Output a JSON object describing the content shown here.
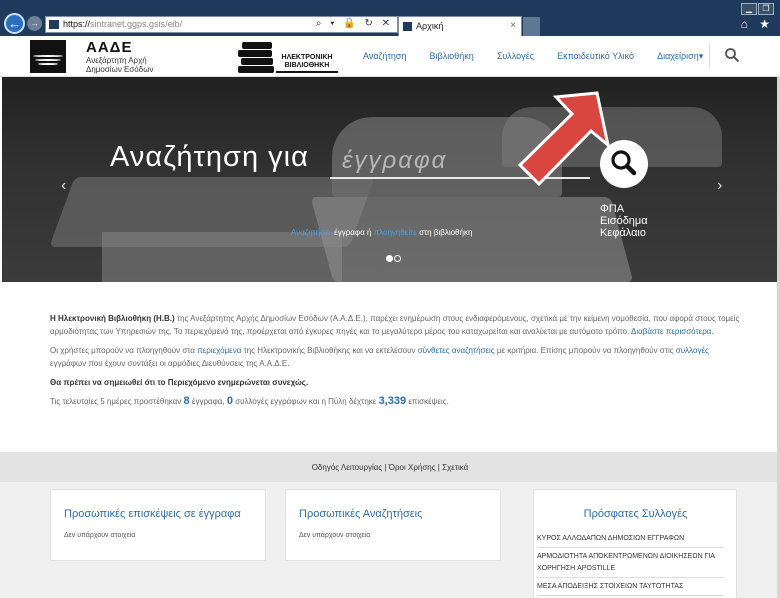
{
  "browser": {
    "url_scheme": "https://",
    "url_host": "sintranet.ggps.gsis",
    "url_path": "/eib/",
    "tab_title": "Αρχική",
    "tab_close": "×",
    "address_tools": "⌕ ▾ 🔒 ↻ ✕",
    "window_buttons": [
      "▁",
      "❐"
    ],
    "right_icons": "⌂ ★"
  },
  "header": {
    "org_name": "ΑΑΔΕ",
    "org_sub_line1": "Ανεξάρτητη Αρχή",
    "org_sub_line2": "Δημοσίων Εσόδων",
    "library_logo_line1": "ΗΛΕΚΤΡΟΝΙΚΗ",
    "library_logo_line2": "ΒΙΒΛΙΟΘΗΚΗ",
    "nav": [
      "Αναζήτηση",
      "Βιβλιοθήκη",
      "Συλλογές",
      "Εκπαιδευτικό Υλικό",
      "Διαχείριση▾"
    ]
  },
  "hero": {
    "title": "Αναζήτηση για",
    "input_text": "έγγραφα",
    "tags": [
      "ΦΠΑ",
      "Εισόδημα",
      "Κεφάλαιο"
    ],
    "sub_link1": "Αναζητήστε",
    "sub_text1": " έγγραφα ή ",
    "sub_link2": "πλοηγηθείτε",
    "sub_text2": " στη βιβλιοθήκη",
    "prev": "‹",
    "next": "›"
  },
  "intro": {
    "p1_bold": "Η Ηλεκτρονική Βιβλιοθήκη (Η.Β.)",
    "p1_text": " της Ανεξάρτητης Αρχής Δημοσίων Εσόδων (Α.Α.Δ.Ε.), παρέχει ενημέρωση στους ενδιαφερόμενους, σχετικά με την κείμενη νομοθεσία, που αφορά στους τομείς αρμοδιότητας των Υπηρεσιών της. Το περιεχόμενό της, προέρχεται από έγκυρες πηγές και το μεγαλύτερο μέρος του καταχωρείται και αναλύεται με αυτόματο τρόπο. ",
    "p1_link": "Διαβάστε περισσότερα.",
    "p2_a": "Οι χρήστες μπορούν να πλοηγηθούν στα ",
    "p2_link1": "περιεχόμενα",
    "p2_b": " της Ηλεκτρονικής Βιβλιοθήκης και να εκτελέσουν ",
    "p2_link2": "σύνθετες αναζητήσεις",
    "p2_c": " με κριτήρια. Επίσης μπορούν να πλοηγηθούν στις ",
    "p2_link3": "συλλογές",
    "p2_d": " εγγράφων που έχουν συντάξει οι αρμόδιες Διευθύνσεις της Α.Α.Δ.Ε.",
    "p3_bold": "Θα πρέπει να σημειωθεί ότι το Περιεχόμενο ενημερώνεται συνεχώς.",
    "p4_a": "Τις τελευταίες 5 ημέρες προστέθηκαν ",
    "p4_docs": "8",
    "p4_b": " έγγραφα, ",
    "p4_colls": "0",
    "p4_c": " συλλογές εγγράφων και η Πύλη δέχτηκε ",
    "p4_visits": "3,339",
    "p4_d": " επισκέψεις."
  },
  "footer": {
    "links": "Οδηγός Λειτουργίας | Όροι Χρήσης | Σχετικά"
  },
  "panels": {
    "p1_title": "Προσωπικές επισκέψεις σε έγγραφα",
    "p1_empty": "Δεν υπάρχουν στοιχεία",
    "p2_title": "Προσωπικές Αναζητήσεις",
    "p2_empty": "Δεν υπάρχουν στοιχεία",
    "p3_title": "Πρόσφατες Συλλογές",
    "p3_items": [
      "ΚΥΡΟΣ ΑΛΛΟΔΑΠΩΝ ΔΗΜΟΣΙΩΝ ΕΓΓΡΑΦΩΝ",
      "ΑΡΜΟΔΙΟΤΗΤΑ ΑΠΟΚΕΝΤΡΩΜΕΝΩΝ ΔΙΟΙΚΗΣΕΩΝ ΓΙΑ ΧΟΡΗΓΗΣΗ APOSTILLE",
      "ΜΕΣΑ ΑΠΟΔΕΙΞΗΣ ΣΤΟΙΧΕΙΩΝ ΤΑΥΤΟΤΗΤΑΣ"
    ]
  },
  "colors": {
    "link": "#2e6ea8",
    "chrome": "#1f3a5c",
    "annotation_arrow": "#d9453f"
  }
}
